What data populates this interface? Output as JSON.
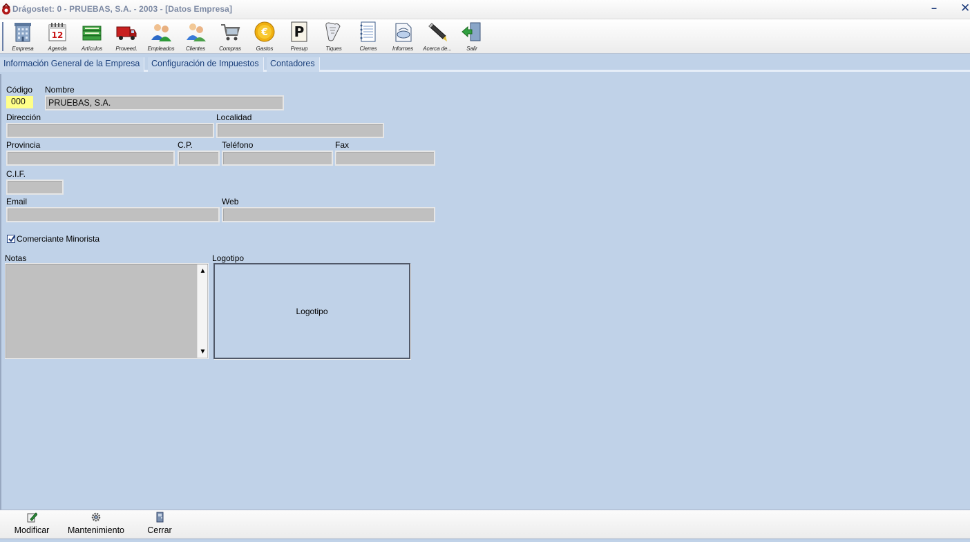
{
  "window": {
    "title": "Drágostet: 0 - PRUEBAS, S.A. - 2003 - [Datos Empresa]",
    "minimize_glyph": "–",
    "close_glyph": "✕"
  },
  "toolbar": {
    "items": [
      {
        "label": "Empresa",
        "icon": "building-icon"
      },
      {
        "label": "Agenda",
        "icon": "calendar-icon"
      },
      {
        "label": "Artículos",
        "icon": "boxes-icon"
      },
      {
        "label": "Proveed.",
        "icon": "truck-icon"
      },
      {
        "label": "Empleados",
        "icon": "employees-icon"
      },
      {
        "label": "Clientes",
        "icon": "clients-icon"
      },
      {
        "label": "Compras",
        "icon": "cart-icon"
      },
      {
        "label": "Gastos",
        "icon": "euro-coin-icon"
      },
      {
        "label": "Presup",
        "icon": "budget-p-icon"
      },
      {
        "label": "Tiques",
        "icon": "receipt-scroll-icon"
      },
      {
        "label": "Cierres",
        "icon": "notebook-icon"
      },
      {
        "label": "Informes",
        "icon": "report-icon"
      },
      {
        "label": "Acerca de...",
        "icon": "pen-icon"
      },
      {
        "label": "Salir",
        "icon": "exit-door-icon"
      }
    ]
  },
  "tabs": [
    "Información General de la Empresa",
    "Configuración de Impuestos",
    "Contadores"
  ],
  "form": {
    "codigo_label": "Código",
    "codigo_value": "000",
    "nombre_label": "Nombre",
    "nombre_value": "PRUEBAS, S.A.",
    "direccion_label": "Dirección",
    "direccion_value": "",
    "localidad_label": "Localidad",
    "localidad_value": "",
    "provincia_label": "Provincia",
    "provincia_value": "",
    "cp_label": "C.P.",
    "cp_value": "",
    "telefono_label": "Teléfono",
    "telefono_value": "",
    "fax_label": "Fax",
    "fax_value": "",
    "cif_label": "C.I.F.",
    "cif_value": "",
    "email_label": "Email",
    "email_value": "",
    "web_label": "Web",
    "web_value": "",
    "comerciante_label": "Comerciante Minorista",
    "comerciante_checked": true,
    "notas_label": "Notas",
    "notas_value": "",
    "logotipo_label": "Logotipo",
    "logotipo_placeholder": "Logotipo"
  },
  "bottom": {
    "buttons": [
      {
        "label": "Modificar",
        "icon": "edit-icon"
      },
      {
        "label": "Mantenimiento",
        "icon": "gear-icon"
      },
      {
        "label": "Cerrar",
        "icon": "close-door-icon"
      }
    ]
  },
  "colors": {
    "background": "#c0d2e8",
    "field": "#c0c0c0",
    "code_field": "#ffff88",
    "tab_text": "#1a3f7a"
  }
}
